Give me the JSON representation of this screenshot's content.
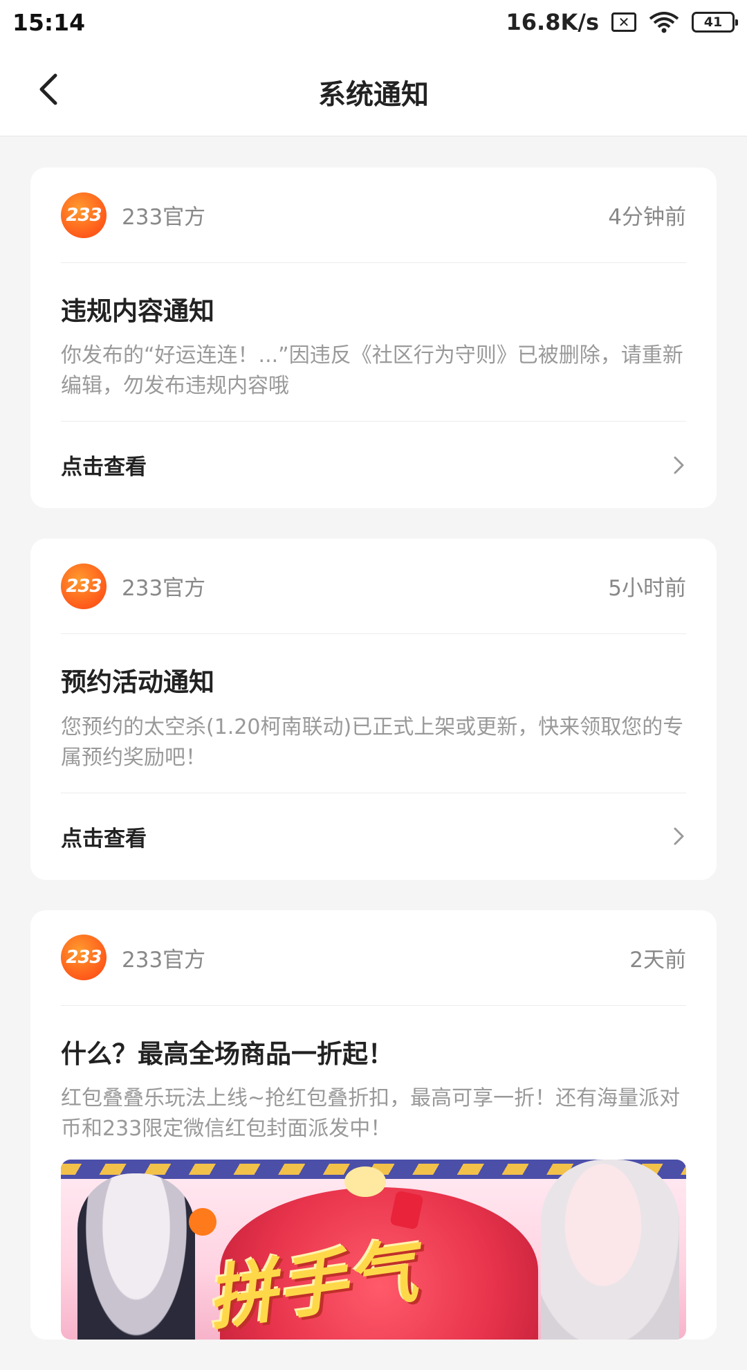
{
  "status_bar": {
    "time": "15:14",
    "net_speed": "16.8K/s",
    "sim_icon": "sim-off-icon",
    "wifi_icon": "wifi-icon",
    "battery": "41"
  },
  "nav": {
    "title": "系统通知",
    "back_icon": "chevron-left-icon"
  },
  "notifications": [
    {
      "sender": "233官方",
      "avatar_text": "233",
      "time": "4分钟前",
      "title": "违规内容通知",
      "body": "你发布的“好运连连！...”因违反《社区行为守则》已被删除，请重新编辑，勿发布违规内容哦",
      "action": "点击查看"
    },
    {
      "sender": "233官方",
      "avatar_text": "233",
      "time": "5小时前",
      "title": "预约活动通知",
      "body": "您预约的太空杀(1.20柯南联动)已正式上架或更新，快来领取您的专属预约奖励吧！",
      "action": "点击查看"
    },
    {
      "sender": "233官方",
      "avatar_text": "233",
      "time": "2天前",
      "title": "什么？最高全场商品一折起！",
      "body": "红包叠叠乐玩法上线~抢红包叠折扣，最高可享一折！还有海量派对币和233限定微信红包封面派发中！",
      "banner_text": "拼手气"
    }
  ],
  "colors": {
    "accent": "#ff6a1a",
    "background": "#f5f5f5",
    "card": "#ffffff",
    "muted_text": "#999999"
  }
}
